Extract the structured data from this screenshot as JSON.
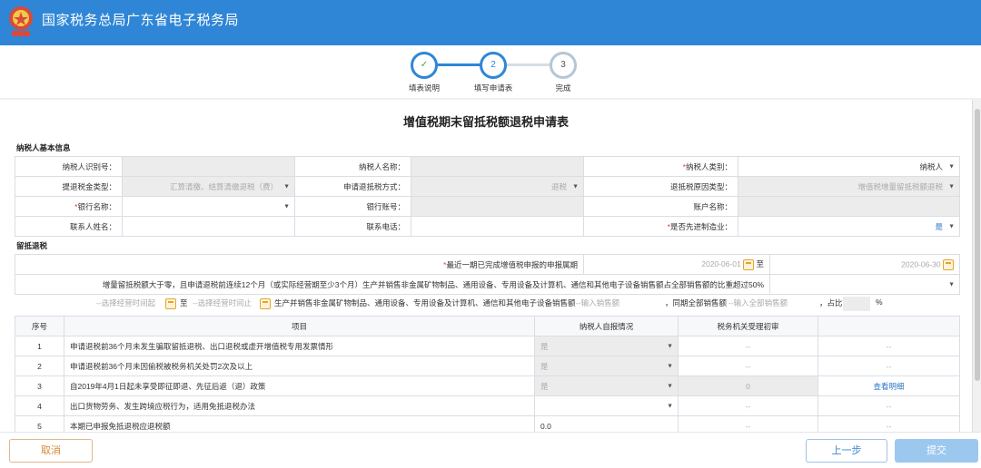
{
  "app": {
    "title": "国家税务总局广东省电子税务局"
  },
  "steps": [
    {
      "num": "✓",
      "label": "填表说明"
    },
    {
      "num": "2",
      "label": "填写申请表"
    },
    {
      "num": "3",
      "label": "完成"
    }
  ],
  "form": {
    "title": "增值税期末留抵税额退税申请表",
    "basic_section": "纳税人基本信息",
    "fields": {
      "taxpayer_id_label": "纳税人识别号：",
      "taxpayer_name_label": "纳税人名称：",
      "taxpayer_type_label": "纳税人类别：",
      "taxpayer_type_value": "纳税人",
      "refund_type_label": "提退税金类型：",
      "refund_type_value": "汇算清缴、结算清缴退税（费）",
      "refund_method_label": "申请退抵税方式：",
      "refund_method_value": "退税",
      "refund_reason_label": "退抵税原因类型：",
      "refund_reason_value": "增值税增量留抵税额退税",
      "bank_name_label": "银行名称：",
      "bank_account_label": "银行账号：",
      "account_name_label": "账户名称：",
      "contact_name_label": "联系人姓名：",
      "contact_phone_label": "联系电话：",
      "advanced_mfg_label": "是否先进制造业：",
      "advanced_mfg_value": "是"
    },
    "retention_section": "留抵退税",
    "period": {
      "label": "最近一期已完成增值税申报的申报属期",
      "start": "2020-06-01",
      "to": "至",
      "end": "2020-06-30"
    },
    "question_text": "增量留抵税额大于零，且申请退税前连续12个月（或实际经营期至少3个月）生产并销售非金属矿物制品、通用设备、专用设备及计算机、通信和其他电子设备销售额占全部销售额的比重超过50%",
    "ratio_row": {
      "start_placeholder": "--选择经营时间起",
      "to": "至",
      "end_placeholder": "--选择经营时间止",
      "sales_label": "生产并销售非金属矿物制品、通用设备、专用设备及计算机、通信和其他电子设备销售额",
      "sales_placeholder": "--输入销售额",
      "total_label": "，同期全部销售额",
      "total_placeholder": "--输入全部销售额",
      "ratio_label": "，占比",
      "percent": "%"
    },
    "table": {
      "headers": [
        "序号",
        "项目",
        "纳税人自报情况",
        "税务机关受理初审",
        ""
      ],
      "rows": [
        {
          "no": "1",
          "item": "申请退税前36个月未发生骗取留抵退税、出口退税或虚开增值税专用发票情形",
          "self": "是",
          "review": "--",
          "extra": "--"
        },
        {
          "no": "2",
          "item": "申请退税前36个月未因偷税被税务机关处罚2次及以上",
          "self": "是",
          "review": "--",
          "extra": "--"
        },
        {
          "no": "3",
          "item": "自2019年4月1日起未享受即征即退、先征后返（退）政策",
          "self": "是",
          "review": "0",
          "extra": "查看明细"
        },
        {
          "no": "4",
          "item": "出口货物劳务、发生跨境应税行为，适用免抵退税办法",
          "self": "",
          "review": "--",
          "extra": "--"
        },
        {
          "no": "5",
          "item": "本期已申报免抵退税应退税额",
          "self": "0.0",
          "review": "--",
          "extra": "--"
        }
      ]
    }
  },
  "footer": {
    "cancel": "取消",
    "prev": "上一步",
    "submit": "提交"
  },
  "colors": {
    "brand": "#2f86d6",
    "step_done": "#2f86d6",
    "step_active": "#2f86d6",
    "cancel": "#d68a3a",
    "submit": "#9cc8ef"
  }
}
